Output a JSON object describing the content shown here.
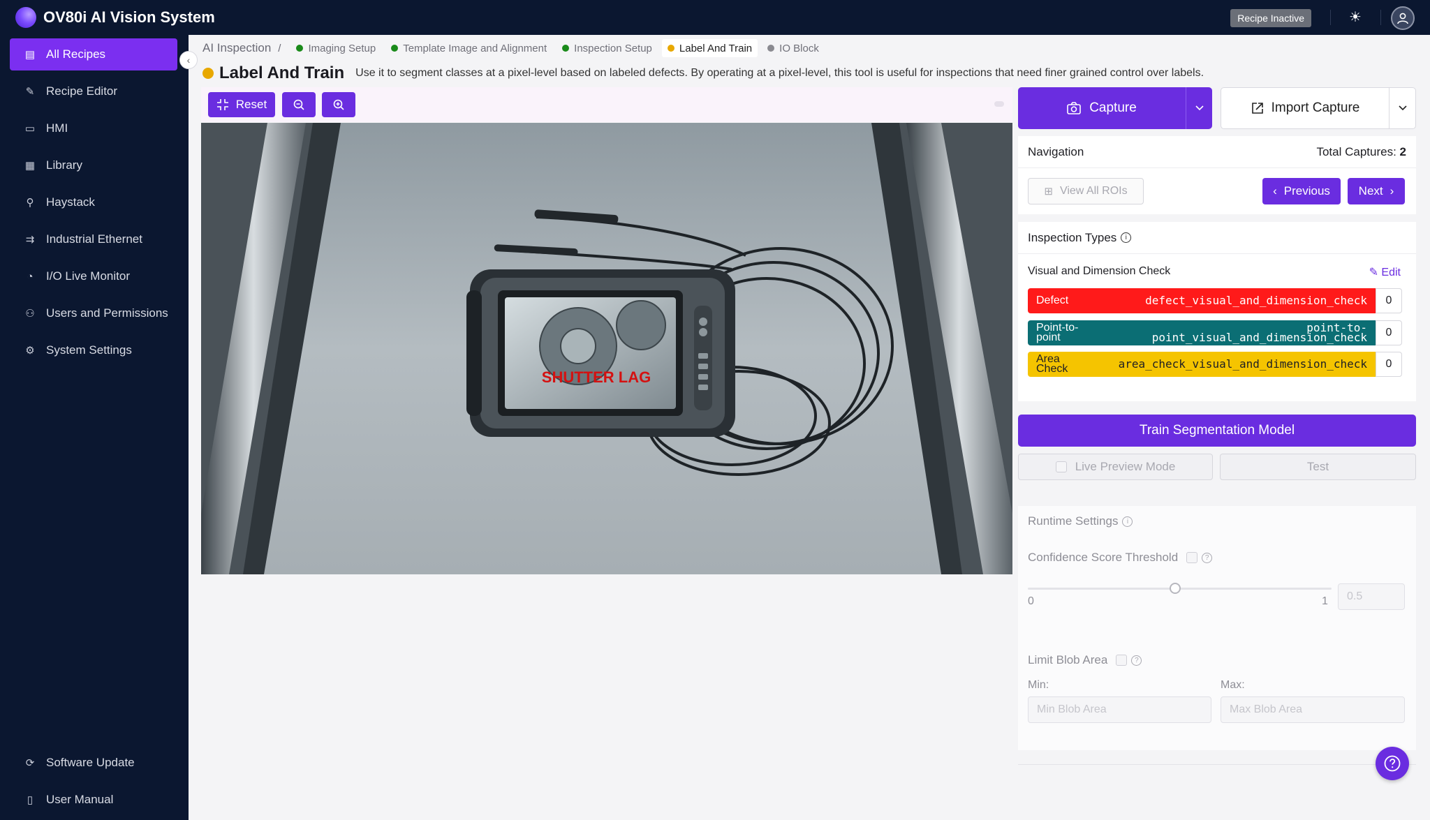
{
  "app": {
    "title": "OV80i AI Vision System",
    "recipe_status": "Recipe Inactive"
  },
  "sidebar": {
    "items": [
      {
        "label": "All Recipes",
        "icon": "document-icon",
        "active": true
      },
      {
        "label": "Recipe Editor",
        "icon": "pencil-icon"
      },
      {
        "label": "HMI",
        "icon": "monitor-icon"
      },
      {
        "label": "Library",
        "icon": "table-icon"
      },
      {
        "label": "Haystack",
        "icon": "search-icon"
      },
      {
        "label": "Industrial Ethernet",
        "icon": "network-icon"
      },
      {
        "label": "I/O Live Monitor",
        "icon": "gauge-icon"
      },
      {
        "label": "Users and Permissions",
        "icon": "user-icon"
      },
      {
        "label": "System Settings",
        "icon": "gear-icon"
      }
    ],
    "bottom": [
      {
        "label": "Software Update",
        "icon": "refresh-icon"
      },
      {
        "label": "User Manual",
        "icon": "book-icon"
      }
    ]
  },
  "breadcrumb": {
    "root": "AI Inspection",
    "separator": "/",
    "steps": [
      {
        "label": "Imaging Setup",
        "color": "#1a8a1a"
      },
      {
        "label": "Template Image and Alignment",
        "color": "#1a8a1a"
      },
      {
        "label": "Inspection Setup",
        "color": "#1a8a1a"
      },
      {
        "label": "Label And Train",
        "color": "#e8a800",
        "current": true
      },
      {
        "label": "IO Block",
        "color": "#8a8a90"
      }
    ]
  },
  "page": {
    "title": "Label And Train",
    "description": "Use it to segment classes at a pixel-level based on labeled defects. By operating at a pixel-level, this tool is useful for inspections that need finer grained control over labels."
  },
  "toolbar": {
    "reset_label": "Reset"
  },
  "image": {
    "overlay_text": "SHUTTER LAG"
  },
  "capture": {
    "capture_label": "Capture",
    "import_label": "Import Capture"
  },
  "navigation": {
    "title": "Navigation",
    "total_label": "Total Captures:",
    "total_value": "2",
    "view_all_label": "View All ROIs",
    "previous_label": "Previous",
    "next_label": "Next"
  },
  "inspection_types": {
    "title": "Inspection Types",
    "check_name": "Visual and Dimension Check",
    "edit_label": "Edit",
    "labels": [
      {
        "name": "Defect",
        "key": "defect_visual_and_dimension_check",
        "count": "0",
        "color": "#ff1a1a"
      },
      {
        "name": "Point-to-point",
        "key": "point_visual_and_dimension_check",
        "key_prefix": "point-to-",
        "count": "0",
        "color": "#0b6e74"
      },
      {
        "name": "Area Check",
        "key": "area_check_visual_and_dimension_check",
        "count": "0",
        "color": "#f5c400"
      }
    ]
  },
  "actions": {
    "train_label": "Train Segmentation Model",
    "live_preview_label": "Live Preview Mode",
    "test_label": "Test"
  },
  "runtime": {
    "title": "Runtime Settings",
    "confidence_label": "Confidence Score Threshold",
    "slider_min": "0",
    "slider_max": "1",
    "slider_value": 0.5,
    "threshold_placeholder": "0.5",
    "limit_blob_label": "Limit Blob Area",
    "min_label": "Min:",
    "max_label": "Max:",
    "min_placeholder": "Min Blob Area",
    "max_placeholder": "Max Blob Area"
  }
}
